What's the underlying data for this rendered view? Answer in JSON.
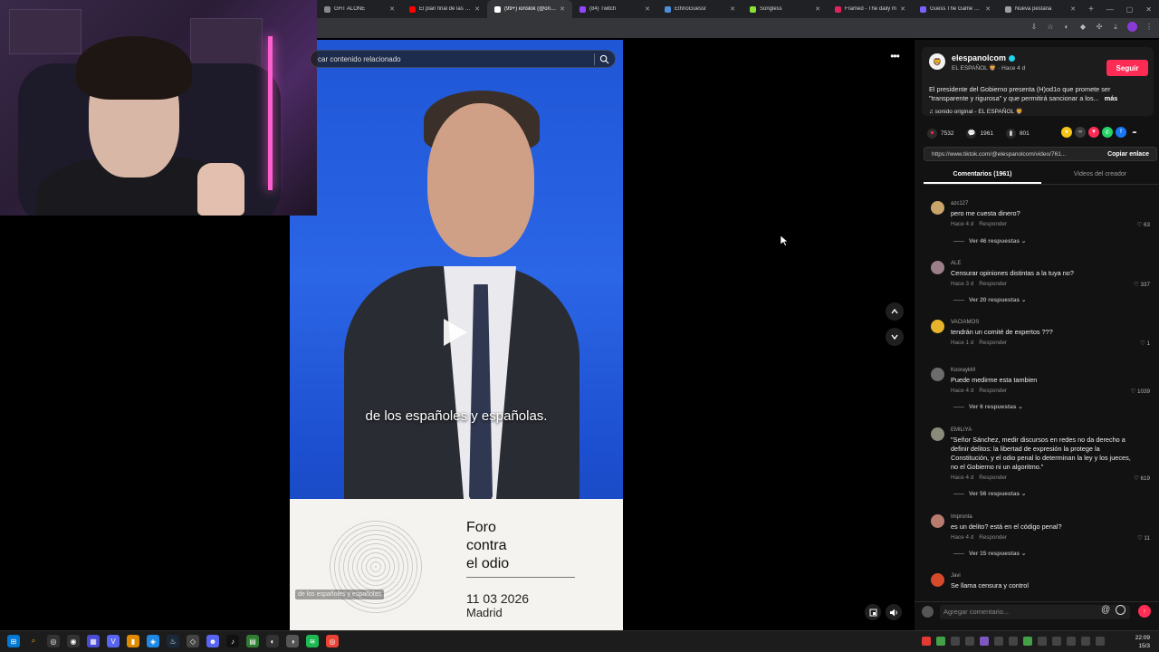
{
  "browser": {
    "tabs": [
      {
        "title": "GHT ALONE",
        "color": "#888888"
      },
      {
        "title": "El plan final de las élites",
        "color": "#ff0000"
      },
      {
        "title": "(99+) ionslok (@onslok",
        "color": "#ffffff",
        "active": true
      },
      {
        "title": "(84) Twitch",
        "color": "#9146ff"
      },
      {
        "title": "EthnoGuessr",
        "color": "#4a90d9"
      },
      {
        "title": "Songless",
        "color": "#8ae234"
      },
      {
        "title": "Framed - The daily m",
        "color": "#e0245e"
      },
      {
        "title": "Guess The Game #14",
        "color": "#7b61ff"
      },
      {
        "title": "Nueva pestaña",
        "color": "#9aa0a6"
      }
    ]
  },
  "search": {
    "placeholder": "car contenido relacionado"
  },
  "video": {
    "subtitle": "de los españoles y españolas.",
    "small_subtitle": "de los españoles y españolas",
    "banner_title": "Foro\ncontra\nel odio",
    "banner_date": "11 03 2026",
    "banner_city": "Madrid"
  },
  "author": {
    "name": "elespanolcom",
    "sub": "EL ESPAÑOL 🦁 · Hace 4 d",
    "follow": "Seguir",
    "description": "El presidente del Gobierno presenta (H)od1o que promete ser \"transparente y rigurosa\" y que permitirá sancionar a los...",
    "more": "más",
    "sound": "♫  sonido original - EL ESPAÑOL 🦁"
  },
  "stats": {
    "likes": "7532",
    "comments": "1961",
    "saves": "801"
  },
  "link": {
    "url": "https://www.tiktok.com/@elespanolcom/video/761...",
    "copy": "Copiar enlace"
  },
  "panel_tabs": {
    "comments": "Comentarios (1961)",
    "creator": "Videos del creador"
  },
  "comments": [
    {
      "user": "azc127",
      "text": "pero me cuesta dinero?",
      "meta": "Hace 4 d",
      "reply": "Responder",
      "likes": "63",
      "replies": "Ver 46 respuestas ⌄",
      "color": "#c9a56b"
    },
    {
      "user": "ALE",
      "text": "Censurar opiniones distintas a la tuya no?",
      "meta": "Hace 3 d",
      "reply": "Responder",
      "likes": "337",
      "replies": "Ver 20 respuestas ⌄",
      "color": "#9a7f88"
    },
    {
      "user": "VACIAMOS",
      "text": "tendrán un comité de expertos ???",
      "meta": "Hace 1 d",
      "reply": "Responder",
      "likes": "1",
      "replies": "",
      "color": "#e6b42a"
    },
    {
      "user": "KooraykM",
      "text": "Puede medirme esta tambien",
      "meta": "Hace 4 d",
      "reply": "Responder",
      "likes": "1039",
      "replies": "Ver 6 respuestas ⌄",
      "color": "#6c6c6c"
    },
    {
      "user": "EMILIYA",
      "text": "\"Señor Sánchez, medir discursos en redes no da derecho a definir delitos: la libertad de expresión la protege la Constitución, y el odio penal lo determinan la ley y los jueces, no el Gobierno ni un algoritmo.\"",
      "meta": "Hace 4 d",
      "reply": "Responder",
      "likes": "619",
      "replies": "Ver 56 respuestas ⌄",
      "color": "#8b8b7a"
    },
    {
      "user": "Impronta",
      "text": "es un delito? está en el código penal?",
      "meta": "Hace 4 d",
      "reply": "Responder",
      "likes": "11",
      "replies": "Ver 15 respuestas ⌄",
      "color": "#b87c6e"
    },
    {
      "user": "Javi",
      "text": "Se llama censura y control",
      "meta": "",
      "reply": "",
      "likes": "",
      "replies": "",
      "color": "#d44a2a"
    }
  ],
  "add_comment": {
    "placeholder": "Agregar comentario..."
  },
  "clock": {
    "time": "22:09",
    "date": "15/3"
  }
}
